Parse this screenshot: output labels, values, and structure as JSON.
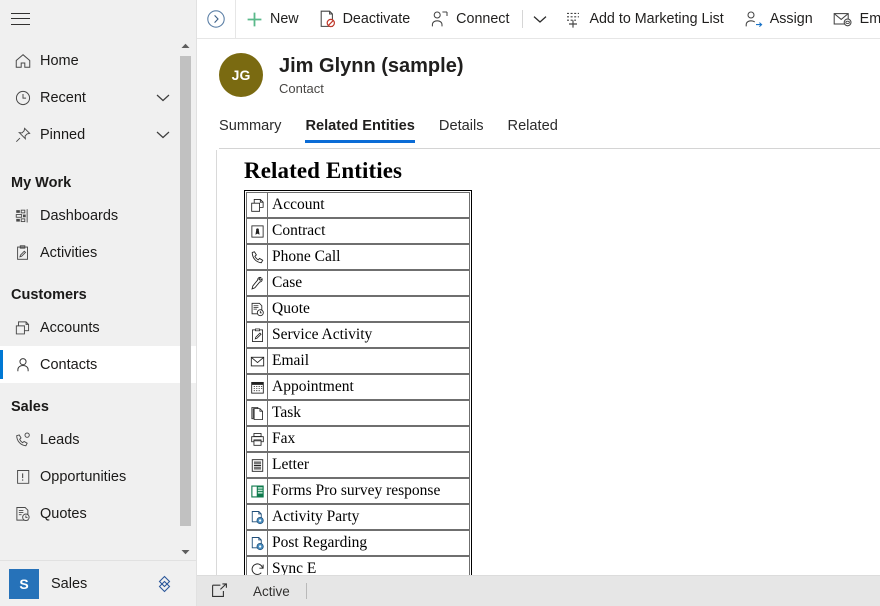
{
  "sidebar": {
    "menu_button": "hamburger-menu",
    "top_items": [
      {
        "label": "Home",
        "icon": "home-icon",
        "chevron": false
      },
      {
        "label": "Recent",
        "icon": "clock-icon",
        "chevron": true
      },
      {
        "label": "Pinned",
        "icon": "pin-icon",
        "chevron": true
      }
    ],
    "groups": [
      {
        "title": "My Work",
        "items": [
          {
            "label": "Dashboards",
            "icon": "dashboard-icon",
            "selected": false
          },
          {
            "label": "Activities",
            "icon": "activities-icon",
            "selected": false
          }
        ]
      },
      {
        "title": "Customers",
        "items": [
          {
            "label": "Accounts",
            "icon": "account-icon",
            "selected": false
          },
          {
            "label": "Contacts",
            "icon": "contact-person-icon",
            "selected": true
          }
        ]
      },
      {
        "title": "Sales",
        "items": [
          {
            "label": "Leads",
            "icon": "lead-icon",
            "selected": false
          },
          {
            "label": "Opportunities",
            "icon": "opportunity-icon",
            "selected": false
          },
          {
            "label": "Quotes",
            "icon": "quote-icon",
            "selected": false
          }
        ]
      }
    ],
    "app_badge": "S",
    "app_name": "Sales",
    "app_switch_icon": "app-switcher-icon",
    "accent_selected": "#0078d4",
    "app_badge_color": "#2672b9"
  },
  "commandbar": {
    "back_icon": "circle-chevron-right-icon",
    "buttons": [
      {
        "label": "New",
        "icon": "plus-icon"
      },
      {
        "label": "Deactivate",
        "icon": "deactivate-icon"
      },
      {
        "label": "Connect",
        "icon": "connect-icon"
      }
    ],
    "overflow_caret": "chevron-down-icon",
    "buttons2": [
      {
        "label": "Add to Marketing List",
        "icon": "add-to-list-icon"
      },
      {
        "label": "Assign",
        "icon": "assign-person-icon"
      },
      {
        "label": "Em",
        "icon": "email-link-icon"
      }
    ]
  },
  "record": {
    "avatar_initials": "JG",
    "avatar_color": "#7a6a11",
    "title": "Jim Glynn (sample)",
    "subtitle": "Contact"
  },
  "tabs": [
    {
      "label": "Summary",
      "active": false
    },
    {
      "label": "Related Entities",
      "active": true
    },
    {
      "label": "Details",
      "active": false
    },
    {
      "label": "Related",
      "active": false
    }
  ],
  "webresource": {
    "heading": "Related Entities",
    "rows": [
      {
        "label": "Account",
        "icon": "account-doc-icon"
      },
      {
        "label": "Contract",
        "icon": "contract-seal-icon"
      },
      {
        "label": "Phone Call",
        "icon": "phone-handset-icon"
      },
      {
        "label": "Case",
        "icon": "wrench-icon"
      },
      {
        "label": "Quote",
        "icon": "quote-clock-icon"
      },
      {
        "label": "Service Activity",
        "icon": "service-clipboard-icon"
      },
      {
        "label": "Email",
        "icon": "envelope-icon"
      },
      {
        "label": "Appointment",
        "icon": "calendar-icon"
      },
      {
        "label": "Task",
        "icon": "task-pages-icon"
      },
      {
        "label": "Fax",
        "icon": "printer-fax-icon"
      },
      {
        "label": "Letter",
        "icon": "letter-lines-icon"
      },
      {
        "label": "Forms Pro survey response",
        "icon": "forms-pro-icon"
      },
      {
        "label": "Activity Party",
        "icon": "gear-doc-icon"
      },
      {
        "label": "Post Regarding",
        "icon": "gear-doc-icon"
      },
      {
        "label": "Sync E",
        "icon": "sync-error-icon"
      }
    ]
  },
  "statusbar": {
    "icon": "open-record-set-icon",
    "status": "Active"
  }
}
